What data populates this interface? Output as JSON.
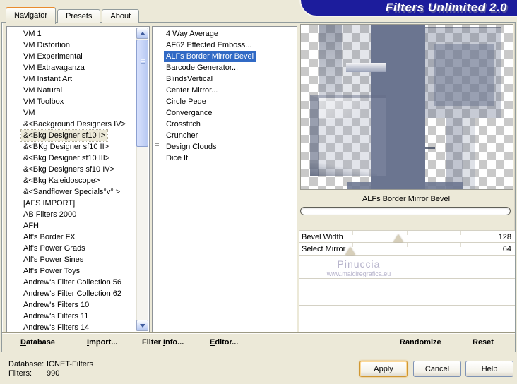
{
  "title": "Filters Unlimited 2.0",
  "tabs": [
    {
      "label": "Navigator",
      "active": true
    },
    {
      "label": "Presets",
      "active": false
    },
    {
      "label": "About",
      "active": false
    }
  ],
  "category_list": {
    "items": [
      "VM 1",
      "VM Distortion",
      "VM Experimental",
      "VM Extravaganza",
      "VM Instant Art",
      "VM Natural",
      "VM Toolbox",
      "VM",
      "&<Background Designers IV>",
      {
        "label": "&<Bkg Designer sf10 I>",
        "selected": true
      },
      "&<BKg Designer sf10 II>",
      "&<Bkg Designer sf10 III>",
      "&<Bkg Designers sf10 IV>",
      "&<Bkg Kaleidoscope>",
      "&<Sandflower Specials°v° >",
      "[AFS IMPORT]",
      "AB Filters 2000",
      "AFH",
      "Alf's Border FX",
      "Alf's Power Grads",
      "Alf's Power Sines",
      "Alf's Power Toys",
      "Andrew's Filter Collection 56",
      "Andrew's Filter Collection 62",
      "Andrew's Filters 10",
      "Andrew's Filters 11",
      "Andrew's Filters 14"
    ]
  },
  "filter_list": {
    "items": [
      "4 Way Average",
      "AF62 Effected Emboss...",
      {
        "label": "ALFs Border Mirror Bevel",
        "selected": true
      },
      "Barcode Generator...",
      "BlindsVertical",
      "Center Mirror...",
      "Circle Pede",
      "Convergance",
      "Crosstitch",
      "Cruncher",
      {
        "label": "Design Clouds",
        "grip": true
      },
      "Dice It"
    ]
  },
  "preview": {
    "filter_title": "ALFs Border Mirror Bevel"
  },
  "params": [
    {
      "label": "Bevel Width",
      "value": "128",
      "thumb_pct": 46
    },
    {
      "label": "Select Mirror",
      "value": "64",
      "thumb_pct": 24
    }
  ],
  "watermark": {
    "name": "Pinuccia",
    "url": "www.maidiregrafica.eu"
  },
  "menu": {
    "database": {
      "pre": "",
      "accel": "D",
      "post": "atabase"
    },
    "import": {
      "pre": "",
      "accel": "I",
      "post": "mport..."
    },
    "filter_info": {
      "pre": "Filter ",
      "accel": "I",
      "post": "nfo..."
    },
    "editor": {
      "pre": "",
      "accel": "E",
      "post": "ditor..."
    }
  },
  "actions": {
    "randomize": "Randomize",
    "reset": "Reset"
  },
  "status": {
    "database_label": "Database:",
    "database_value": "ICNET-Filters",
    "filters_label": "Filters:",
    "filters_value": "990"
  },
  "buttons": {
    "apply": "Apply",
    "cancel": "Cancel",
    "help": "Help"
  },
  "colors": {
    "dialog_bg": "#ece9d8",
    "banner": "#1c1c9c",
    "selection_blue": "#316ac5",
    "inactive_selection": "#ece9d8",
    "preview_slate": "#6b7590",
    "active_tab_stripe": "#e98b2d",
    "watermark_text": "#b6b3cb"
  }
}
